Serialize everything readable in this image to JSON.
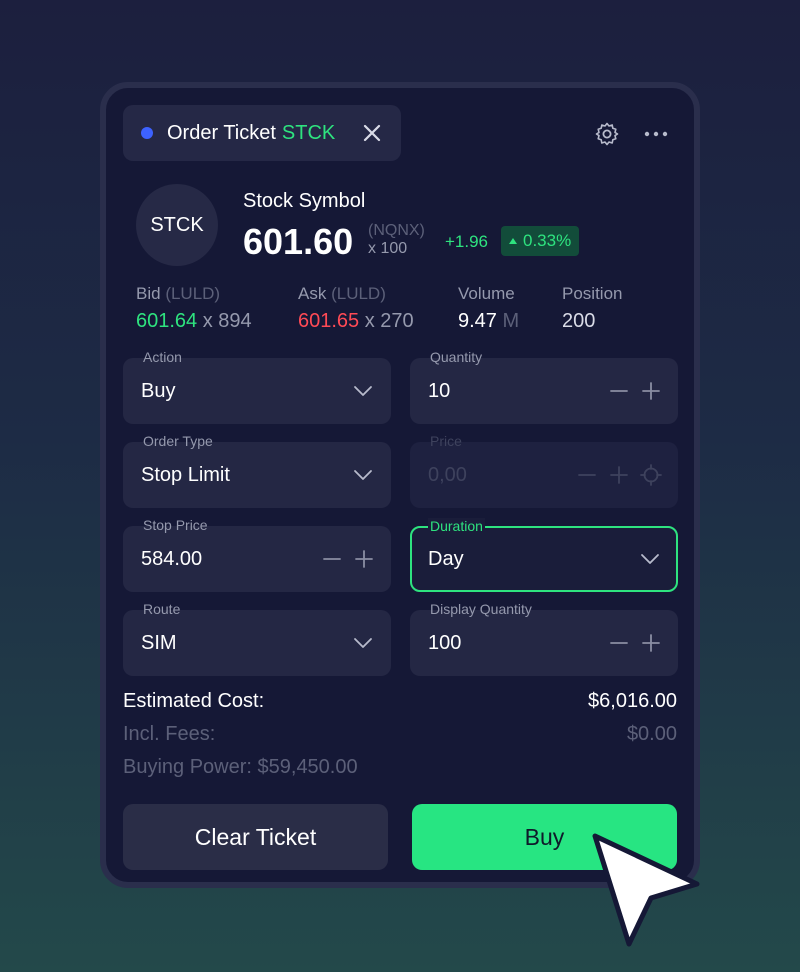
{
  "ticket": {
    "title": "Order Ticket",
    "symbol": "STCK",
    "accent_color": "#2ee37f",
    "dot_color": "#3d62ff"
  },
  "icons": {
    "close": "close-icon",
    "settings": "gear-icon",
    "more": "more-horizontal-icon"
  },
  "quote": {
    "avatar_text": "STCK",
    "name": "Stock Symbol",
    "price": "601.60",
    "exchange": "(NQNX)",
    "multiplier": "x 100",
    "change": "+1.96",
    "change_pct": "0.33%"
  },
  "stats": {
    "bid_label": "Bid",
    "bid_luld": "(LULD)",
    "bid_price": "601.64",
    "bid_size": "x 894",
    "ask_label": "Ask",
    "ask_luld": "(LULD)",
    "ask_price": "601.65",
    "ask_size": "x 270",
    "volume_label": "Volume",
    "volume_value": "9.47",
    "volume_unit": "M",
    "position_label": "Position",
    "position_value": "200"
  },
  "form": {
    "action": {
      "label": "Action",
      "value": "Buy"
    },
    "quantity": {
      "label": "Quantity",
      "value": "10"
    },
    "order_type": {
      "label": "Order Type",
      "value": "Stop Limit"
    },
    "price": {
      "label": "Price",
      "placeholder": "0,00"
    },
    "stop_price": {
      "label": "Stop Price",
      "value": "584.00"
    },
    "duration": {
      "label": "Duration",
      "value": "Day"
    },
    "route": {
      "label": "Route",
      "value": "SIM"
    },
    "display_quantity": {
      "label": "Display Quantity",
      "value": "100"
    }
  },
  "summary": {
    "estimated_cost_label": "Estimated Cost:",
    "estimated_cost_value": "$6,016.00",
    "fees_label": "Incl. Fees:",
    "fees_value": "$0.00",
    "buying_power": "Buying Power: $59,450.00"
  },
  "buttons": {
    "clear": "Clear Ticket",
    "buy": "Buy"
  }
}
